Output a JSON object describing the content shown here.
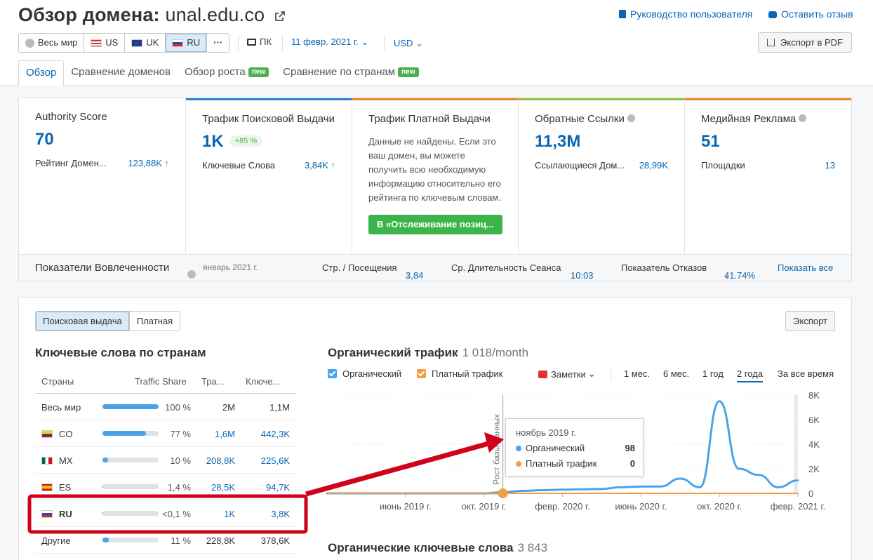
{
  "header": {
    "title": "Обзор домена:",
    "domain": "unal.edu.co",
    "guide_link": "Руководство пользователя",
    "feedback_link": "Оставить отзыв",
    "export_pdf": "Экспорт в PDF"
  },
  "regions": [
    {
      "label": "Весь мир",
      "icon": "globe-icon"
    },
    {
      "label": "US"
    },
    {
      "label": "UK"
    },
    {
      "label": "RU"
    },
    {
      "label": "···"
    }
  ],
  "device": "ПК",
  "date": "11 февр. 2021 г.",
  "currency": "USD",
  "tabs": [
    {
      "label": "Обзор",
      "active": true
    },
    {
      "label": "Сравнение доменов"
    },
    {
      "label": "Обзор роста",
      "badge": "new"
    },
    {
      "label": "Сравнение по странам",
      "badge": "new"
    }
  ],
  "cards": {
    "authority": {
      "title": "Authority Score",
      "value": "70",
      "row_label": "Рейтинг Домен...",
      "row_value": "123,88K",
      "top_color": "#ffffff"
    },
    "organic": {
      "title": "Трафик Поисковой Выдачи",
      "value": "1K",
      "badge": "+85 %",
      "row_label": "Ключевые Слова",
      "row_value": "3,84K",
      "top_color": "#2a7ec8"
    },
    "paid": {
      "title": "Трафик Платной Выдачи",
      "nodata": "Данные не найдены. Если это ваш домен, вы можете получить всю необходимую информацию относительно его рейтинга по ключевым словам.",
      "button": "В «Отслеживание позиц...",
      "top_color": "#e58a2b"
    },
    "backlinks": {
      "title": "Обратные Ссылки",
      "value": "11,3M",
      "row_label": "Ссылающиеся Дом...",
      "row_value": "28,99K",
      "top_color": "#8fc24a"
    },
    "display": {
      "title": "Медийная Реклама",
      "value": "51",
      "row_label": "Площадки",
      "row_value": "13",
      "top_color": "#e58a2b"
    }
  },
  "engagement": {
    "title": "Показатели Вовлеченности",
    "period": "январь 2021 г.",
    "pages_label": "Стр. / Посещения",
    "pages_value": "3,84",
    "duration_label": "Ср. Длительность Сеанса",
    "duration_value": "10:03",
    "bounce_label": "Показатель Отказов",
    "bounce_value": "41.74%",
    "show_all": "Показать все"
  },
  "panel": {
    "toggle": [
      "Поисковая выдача",
      "Платная"
    ],
    "export": "Экспорт",
    "keywords_title": "Ключевые слова по странам",
    "table_headers": [
      "Страны",
      "Traffic Share",
      "Тра...",
      "Ключе..."
    ],
    "rows": [
      {
        "country": "Весь мир",
        "flag": "",
        "share": "100 %",
        "share_pct": 100,
        "traffic": "2M",
        "keywords": "1,1M",
        "bold": false,
        "linked": false
      },
      {
        "country": "CO",
        "flag": "co",
        "share": "77 %",
        "share_pct": 77,
        "traffic": "1,6M",
        "keywords": "442,3K",
        "bold": false,
        "linked": true
      },
      {
        "country": "MX",
        "flag": "mx",
        "share": "10 %",
        "share_pct": 10,
        "traffic": "208,8K",
        "keywords": "225,6K",
        "bold": false,
        "linked": true
      },
      {
        "country": "ES",
        "flag": "es",
        "share": "1,4 %",
        "share_pct": 1.4,
        "traffic": "28,5K",
        "keywords": "94,7K",
        "bold": false,
        "linked": true
      },
      {
        "country": "RU",
        "flag": "ru",
        "share": "<0,1 %",
        "share_pct": 0.05,
        "traffic": "1K",
        "keywords": "3,8K",
        "bold": true,
        "linked": true
      },
      {
        "country": "Другие",
        "flag": "",
        "share": "11 %",
        "share_pct": 11,
        "traffic": "228,8K",
        "keywords": "378,6K",
        "bold": false,
        "linked": false
      }
    ],
    "chart_title": "Органический трафик",
    "chart_subtitle": "1 018/month",
    "legend_organic": "Органический",
    "legend_paid": "Платный трафик",
    "notes": "Заметки",
    "ranges": [
      "1 мес.",
      "6 мес.",
      "1 год",
      "2 года",
      "За все время"
    ],
    "active_range": "2 года",
    "annotation": "Рост базы данных",
    "tooltip": {
      "date": "ноябрь 2019 г.",
      "organic_label": "Органический",
      "organic_value": "98",
      "paid_label": "Платный трафик",
      "paid_value": "0"
    },
    "organic_keywords_title": "Органические ключевые слова",
    "organic_keywords_count": "3 843"
  },
  "chart_data": {
    "type": "line",
    "title": "Органический трафик",
    "x_labels": [
      "июнь 2019 г.",
      "окт. 2019 г.",
      "февр. 2020 г.",
      "июнь 2020 г.",
      "окт. 2020 г.",
      "февр. 2021 г."
    ],
    "y_ticks": [
      "0",
      "2K",
      "4K",
      "6K",
      "8K"
    ],
    "ylim": [
      0,
      8000
    ],
    "x": [
      "2019-02",
      "2019-03",
      "2019-04",
      "2019-05",
      "2019-06",
      "2019-07",
      "2019-08",
      "2019-09",
      "2019-10",
      "2019-11",
      "2019-12",
      "2020-01",
      "2020-02",
      "2020-03",
      "2020-04",
      "2020-05",
      "2020-06",
      "2020-07",
      "2020-08",
      "2020-09",
      "2020-10",
      "2020-11",
      "2020-12",
      "2021-01",
      "2021-02"
    ],
    "series": [
      {
        "name": "Органический",
        "color": "#4aa3e6",
        "values": [
          0,
          0,
          0,
          0,
          0,
          0,
          0,
          0,
          0,
          98,
          200,
          260,
          300,
          330,
          360,
          500,
          550,
          560,
          1200,
          500,
          7500,
          2000,
          1500,
          500,
          1050
        ]
      },
      {
        "name": "Платный трафик",
        "color": "#f0a040",
        "values": [
          0,
          0,
          0,
          0,
          0,
          0,
          0,
          0,
          0,
          0,
          0,
          0,
          0,
          0,
          0,
          0,
          0,
          0,
          0,
          0,
          0,
          0,
          0,
          0,
          0
        ]
      }
    ],
    "grid": true
  },
  "colors": {
    "accent": "#0a66b3",
    "green": "#4caf50",
    "red_arrow": "#d0021b"
  }
}
